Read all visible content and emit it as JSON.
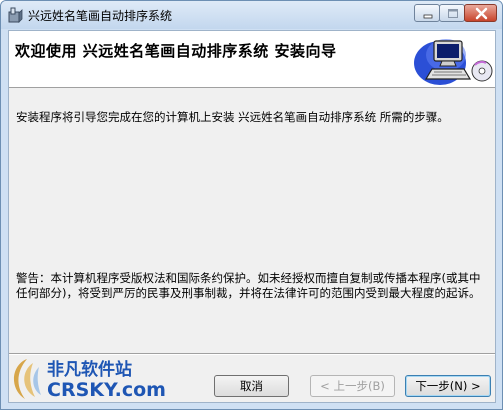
{
  "window": {
    "title": "兴远姓名笔画自动排序系统",
    "icon": "setup-box-icon",
    "controls": {
      "minimize": "minimize-icon",
      "maximize": "maximize-icon",
      "close": "close-icon"
    }
  },
  "header": {
    "title": "欢迎使用  兴远姓名笔画自动排序系统  安装向导",
    "art": "computer-cd-icon"
  },
  "body": {
    "intro": "安装程序将引导您完成在您的计算机上安装 兴远姓名笔画自动排序系统 所需的步骤。",
    "warning": "警告：本计算机程序受版权法和国际条约保护。如未经授权而擅自复制或传播本程序(或其中任何部分)，将受到严厉的民事及刑事制裁，并将在法律许可的范围内受到最大程度的起诉。"
  },
  "buttons": {
    "cancel": "取消",
    "back": "< 上一步(B)",
    "next": "下一步(N) >"
  },
  "watermark": {
    "text_cn": "非凡软件站",
    "text_en": "CRSKY.com"
  },
  "colors": {
    "titlebar": "#c3d7ee",
    "client": "#f0f0f0",
    "close": "#c8442b",
    "logo": "#1e56b4"
  }
}
